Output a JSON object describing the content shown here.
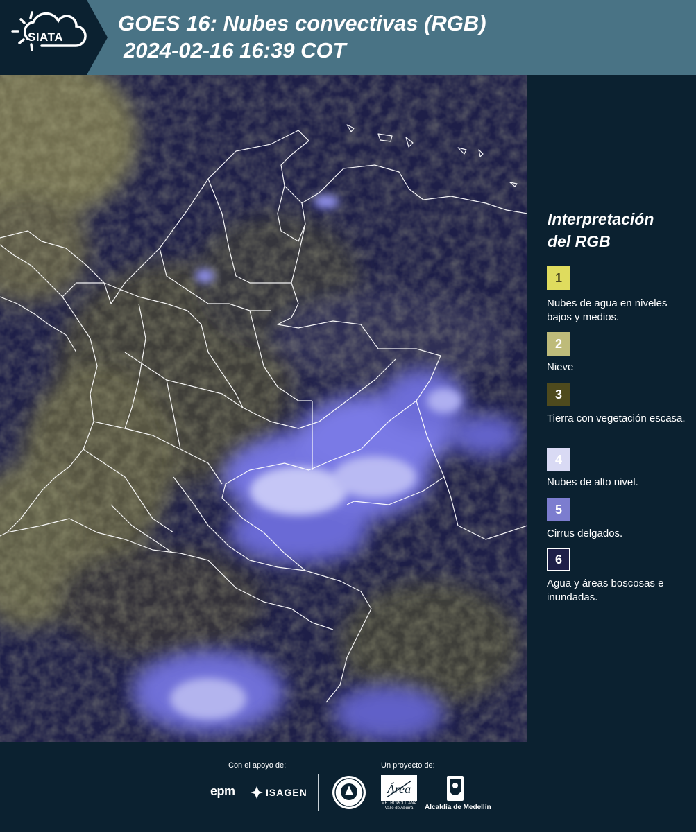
{
  "header": {
    "logo_text": "SIATA",
    "title_line1": "GOES 16: Nubes convectivas (RGB)",
    "title_line2": "2024-02-16 16:39 COT"
  },
  "legend": {
    "title_line1": "Interpretación",
    "title_line2": "del RGB",
    "items": [
      {
        "number": "1",
        "label": "Nubes de agua en niveles bajos y medios.",
        "color": "#dfdc5e"
      },
      {
        "number": "2",
        "label": "Nieve",
        "color": "#bebb7a"
      },
      {
        "number": "3",
        "label": "Tierra con vegetación escasa.",
        "color": "#4e4a1d"
      },
      {
        "number": "4",
        "label": "Nubes de alto nivel.",
        "color": "#d9daf4"
      },
      {
        "number": "5",
        "label": "Cirrus delgados.",
        "color": "#7c7dcf"
      },
      {
        "number": "6",
        "label": "Agua y áreas boscosas e inundadas.",
        "color": "#1e1f48"
      }
    ]
  },
  "footer": {
    "support_label": "Con el apoyo de:",
    "project_label": "Un proyecto de:",
    "epm": "epm",
    "isagen": "ISAGEN",
    "amva_line1": "METROPOLITANA",
    "amva_line2": "Valle de Aburrá",
    "amva_mark": "Área",
    "medellin": "Alcaldía de Medellín"
  },
  "colors": {
    "header_bg": "#497385",
    "panel_bg": "#0b2130",
    "map_water": "#1e1f48",
    "boundary": "#ffffff"
  }
}
